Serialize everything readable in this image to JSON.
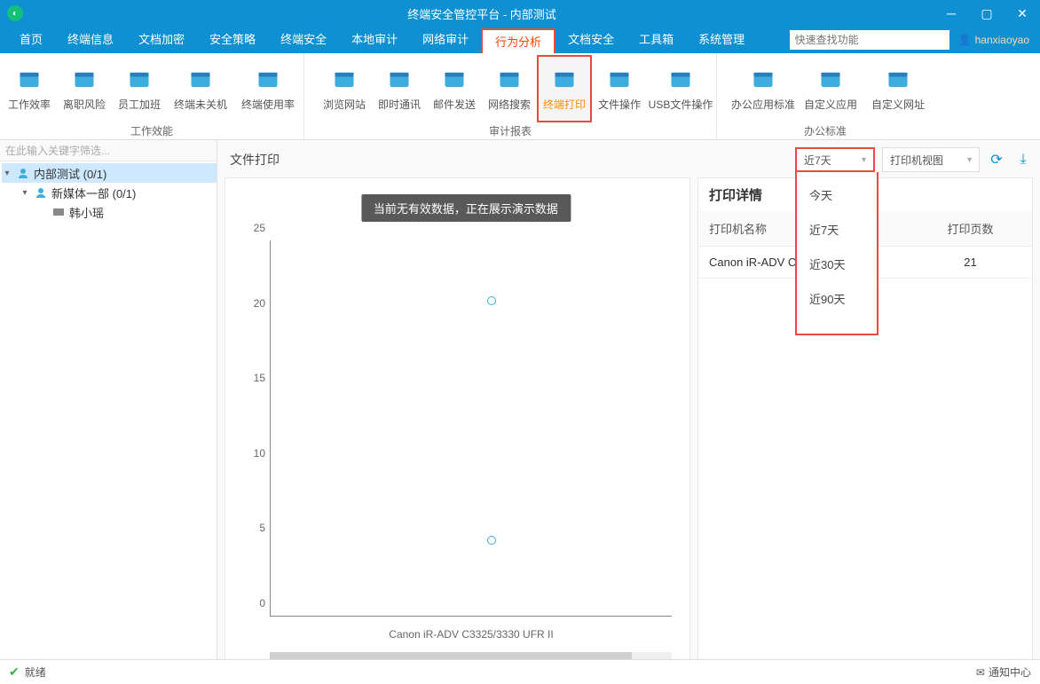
{
  "window": {
    "title": "终端安全管控平台 - 内部测试"
  },
  "menu": {
    "items": [
      "首页",
      "终端信息",
      "文档加密",
      "安全策略",
      "终端安全",
      "本地审计",
      "网络审计",
      "行为分析",
      "文档安全",
      "工具箱",
      "系统管理"
    ],
    "active": "行为分析",
    "search_placeholder": "快速查找功能",
    "user": "hanxiaoyao"
  },
  "ribbon": {
    "groups": [
      {
        "label": "工作效能",
        "items": [
          "工作效率",
          "离职风险",
          "员工加班",
          "终端未关机",
          "终端使用率"
        ]
      },
      {
        "label": "审计报表",
        "items": [
          "浏览网站",
          "即时通讯",
          "邮件发送",
          "网络搜索",
          "终端打印",
          "文件操作",
          "USB文件操作"
        ]
      },
      {
        "label": "办公标准",
        "items": [
          "办公应用标准",
          "自定义应用",
          "自定义网址"
        ]
      }
    ],
    "active": "终端打印"
  },
  "sidebar": {
    "placeholder": "在此输入关键字筛选...",
    "nodes": [
      {
        "depth": 1,
        "label": "内部测试 (0/1)",
        "expanded": true,
        "sel": true,
        "kind": "group"
      },
      {
        "depth": 2,
        "label": "新媒体一部 (0/1)",
        "expanded": true,
        "kind": "group"
      },
      {
        "depth": 3,
        "label": "韩小瑶",
        "kind": "pc"
      }
    ]
  },
  "main": {
    "title": "文件打印",
    "toast": "当前无有效数据，正在展示演示数据",
    "time_dd": "近7天",
    "view_dd": "打印机视图",
    "dd_options": [
      "今天",
      "近7天",
      "近30天",
      "近90天"
    ]
  },
  "detail": {
    "title": "打印详情",
    "cols": [
      "打印机名称",
      "打印页数"
    ],
    "rows": [
      {
        "name": "Canon iR-ADV C3",
        "pages": "21"
      }
    ]
  },
  "chart_data": {
    "type": "scatter",
    "xlabel": "Canon iR-ADV C3325/3330 UFR II",
    "ylim": [
      0,
      25
    ],
    "yticks": [
      0,
      5,
      10,
      15,
      20,
      25
    ],
    "series": [
      {
        "name": "pages",
        "points": [
          {
            "x": 0.55,
            "y": 21
          },
          {
            "x": 0.55,
            "y": 5
          }
        ]
      }
    ]
  },
  "status": {
    "text": "就绪",
    "notify": "通知中心"
  }
}
